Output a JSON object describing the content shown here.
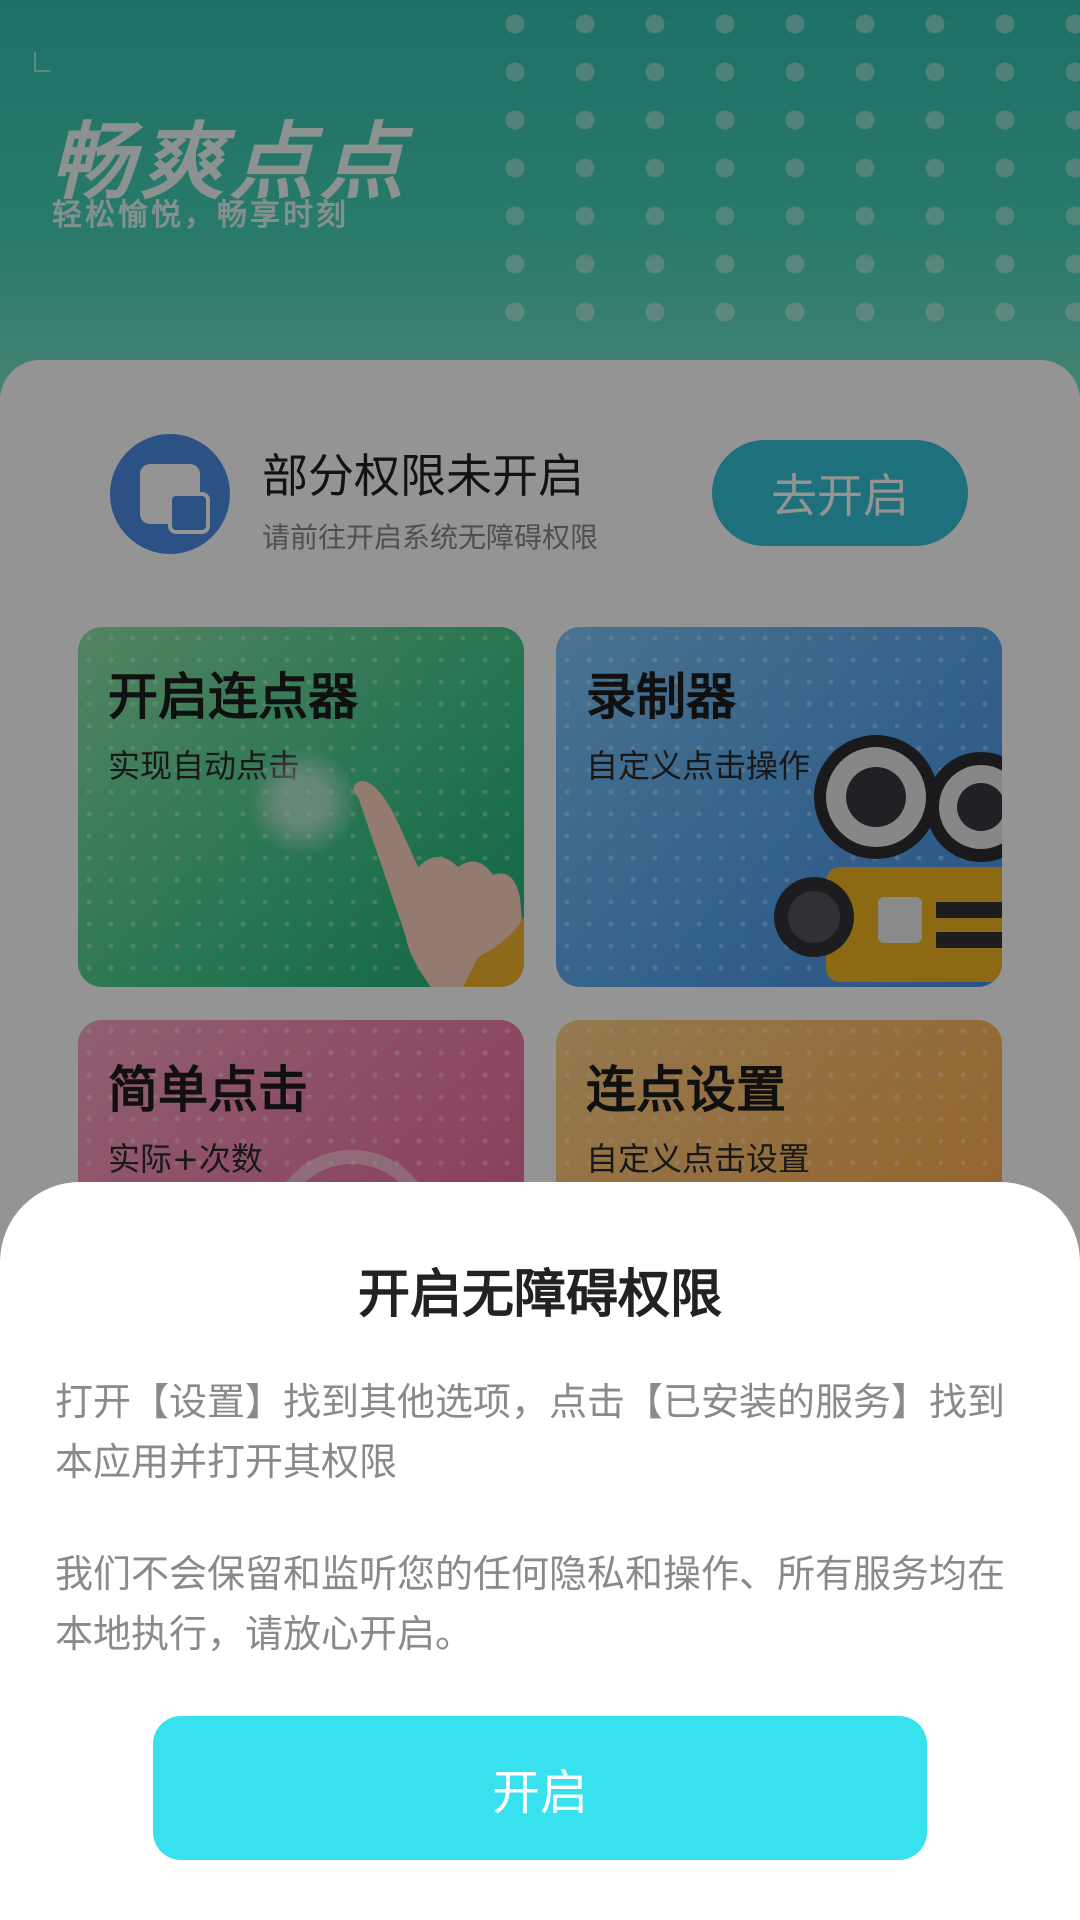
{
  "header": {
    "logo": "畅爽点点",
    "slogan": "轻松愉悦，畅享时刻"
  },
  "permission": {
    "title": "部分权限未开启",
    "subtitle": "请前往开启系统无障碍权限",
    "button": "去开启"
  },
  "features": [
    {
      "title": "开启连点器",
      "subtitle": "实现自动点击",
      "color": "#3fc98a",
      "icon": "tap-hand-icon"
    },
    {
      "title": "录制器",
      "subtitle": "自定义点击操作",
      "color": "#5aa8ef",
      "icon": "film-camera-icon"
    },
    {
      "title": "简单点击",
      "subtitle": "实际+次数",
      "color": "#f07aa8",
      "icon": "target-icon"
    },
    {
      "title": "连点设置",
      "subtitle": "自定义点击设置",
      "color": "#ffb65c",
      "icon": "settings-cube-icon"
    }
  ],
  "dialog": {
    "title": "开启无障碍权限",
    "paragraph1": "打开【设置】找到其他选项，点击【已安装的服务】找到本应用并打开其权限",
    "paragraph2": "我们不会保留和监听您的任何隐私和操作、所有服务均在本地执行，请放心开启。",
    "button": "开启",
    "button_color": "#37e1ee"
  }
}
